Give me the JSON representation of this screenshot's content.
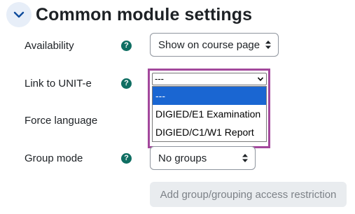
{
  "section": {
    "title": "Common module settings",
    "collapse_icon": "chevron-down-icon"
  },
  "fields": {
    "availability": {
      "label": "Availability",
      "help_icon": "question-icon",
      "value": "Show on course page"
    },
    "link_to_unite": {
      "label": "Link to UNIT-e",
      "help_icon": "question-icon",
      "value": "---",
      "options": [
        "---",
        "DIGIED/E1 Examination",
        "DIGIED/C1/W1 Report"
      ],
      "selected_index": 0
    },
    "force_language": {
      "label": "Force language"
    },
    "group_mode": {
      "label": "Group mode",
      "help_icon": "question-icon",
      "value": "No groups"
    }
  },
  "buttons": {
    "add_restriction_label": "Add group/grouping access restriction"
  },
  "colors": {
    "help_icon_bg": "#0f6e62",
    "highlight_border": "#a3489c",
    "option_selected_bg": "#1a66d2",
    "collapse_bg": "#e7eef8"
  }
}
